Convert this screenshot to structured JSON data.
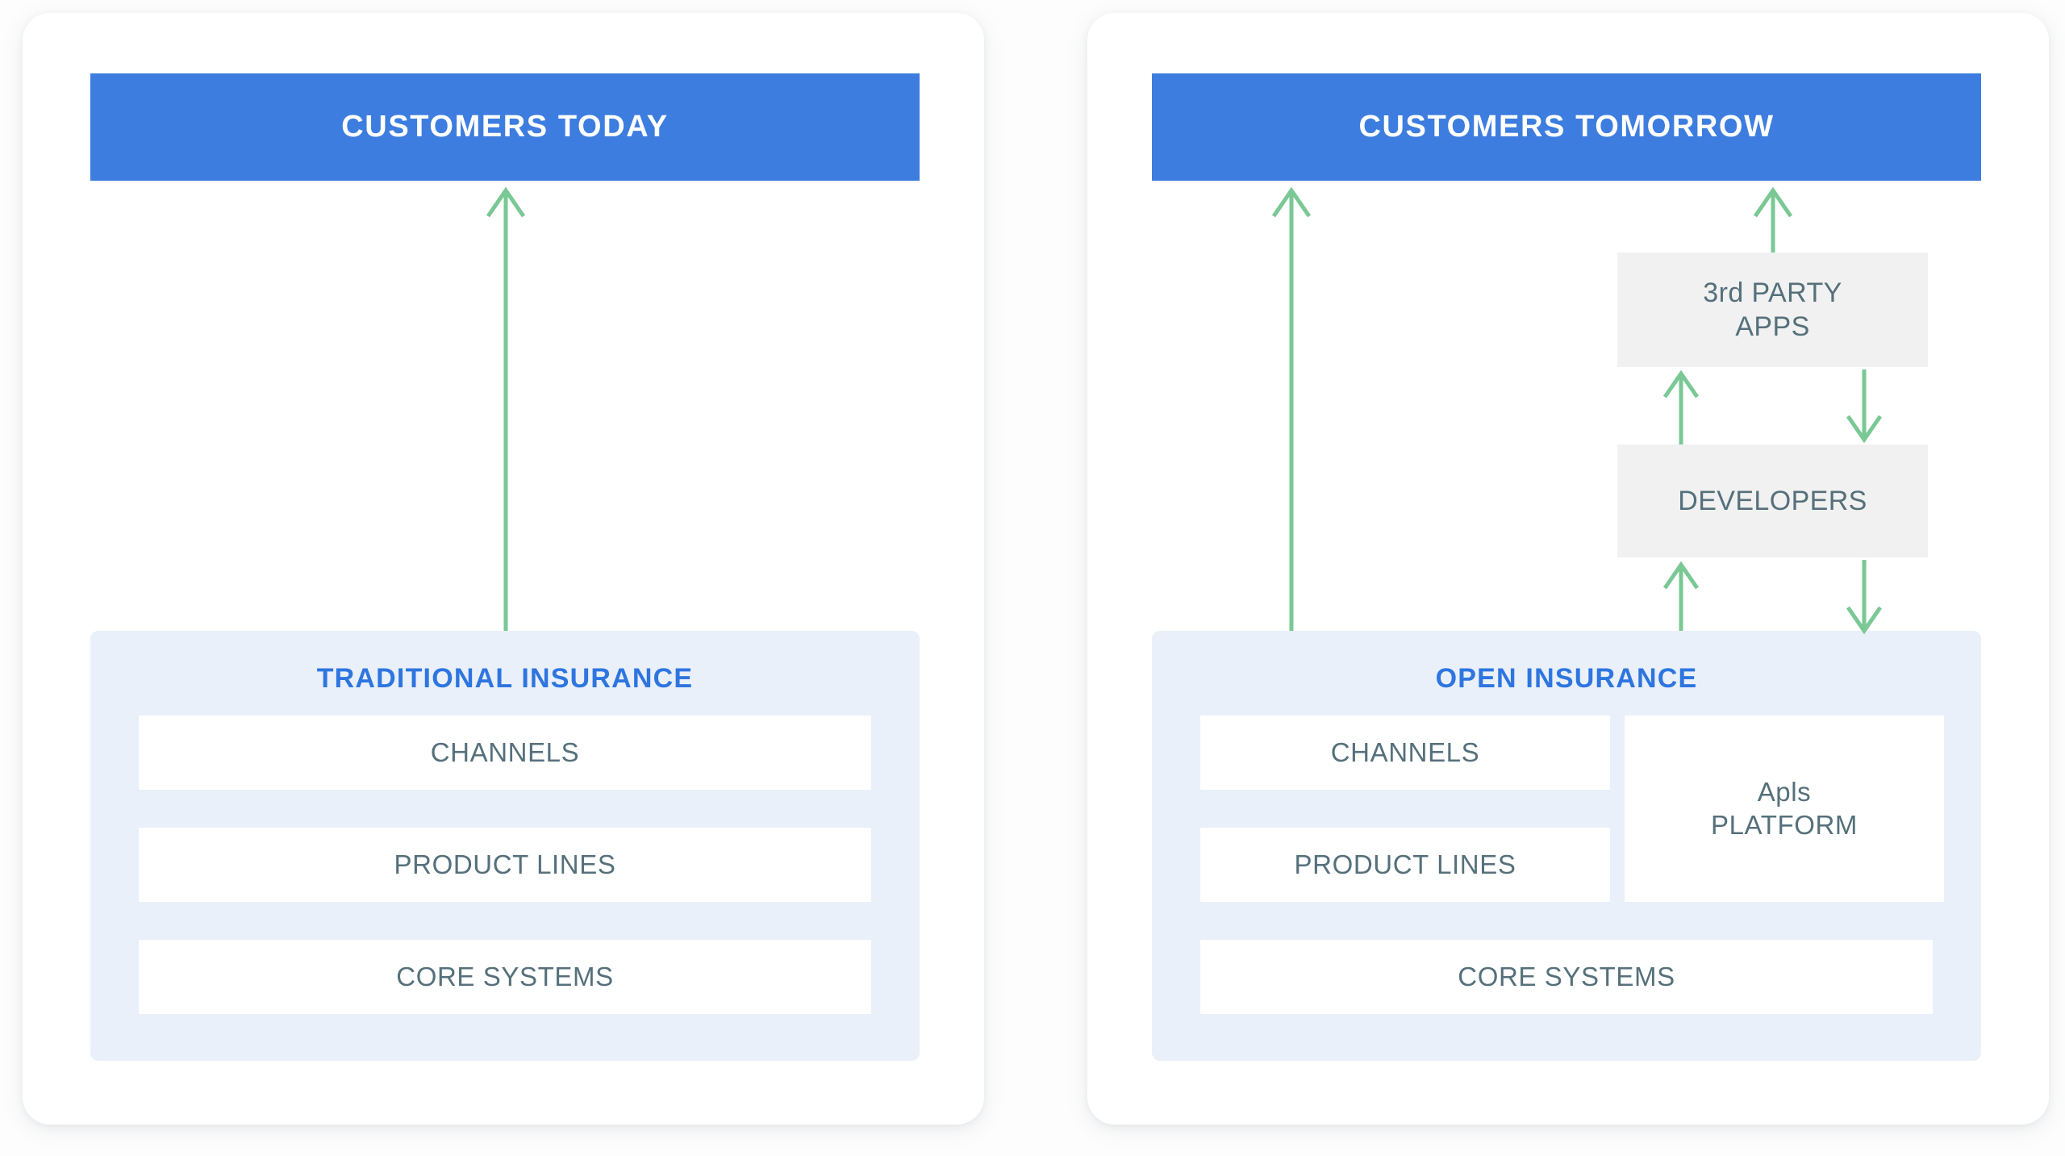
{
  "diagram": {
    "title_left": "CUSTOMERS TODAY",
    "title_right": "CUSTOMERS TOMORROW",
    "colors": {
      "banner_blue": "#3d7ddf",
      "panel_blue": "#e9f0fa",
      "panel_title_blue": "#2e75e0",
      "label_slate": "#55707b",
      "gray_box": "#f1f1f1",
      "arrow_green": "#7ac894",
      "card_white": "#ffffff"
    },
    "left_card": {
      "banner_label": "CUSTOMERS TODAY",
      "panel_title": "TRADITIONAL INSURANCE",
      "rows": [
        {
          "label": "CHANNELS"
        },
        {
          "label": "PRODUCT LINES"
        },
        {
          "label": "CORE SYSTEMS"
        }
      ]
    },
    "right_card": {
      "banner_label": "CUSTOMERS TOMORROW",
      "panel_title": "OPEN INSURANCE",
      "rows": [
        {
          "label": "CHANNELS"
        },
        {
          "label": "PRODUCT LINES"
        },
        {
          "label": "CORE SYSTEMS"
        }
      ],
      "apis_box": {
        "line1": "Apls",
        "line2": "PLATFORM"
      },
      "external_boxes": [
        {
          "line1": "3rd PARTY",
          "line2": "APPS"
        },
        {
          "line1": "DEVELOPERS",
          "line2": ""
        }
      ]
    },
    "flows": [
      {
        "from": "TRADITIONAL INSURANCE",
        "to": "CUSTOMERS TODAY",
        "direction": "up"
      },
      {
        "from": "OPEN INSURANCE",
        "to": "CUSTOMERS TOMORROW",
        "direction": "up"
      },
      {
        "from": "3rd PARTY APPS",
        "to": "CUSTOMERS TOMORROW",
        "direction": "up"
      },
      {
        "from": "DEVELOPERS",
        "to": "3rd PARTY APPS",
        "direction": "up"
      },
      {
        "from": "3rd PARTY APPS",
        "to": "DEVELOPERS",
        "direction": "down"
      },
      {
        "from": "OPEN INSURANCE",
        "to": "DEVELOPERS",
        "direction": "up"
      },
      {
        "from": "DEVELOPERS",
        "to": "OPEN INSURANCE",
        "direction": "down"
      }
    ]
  }
}
